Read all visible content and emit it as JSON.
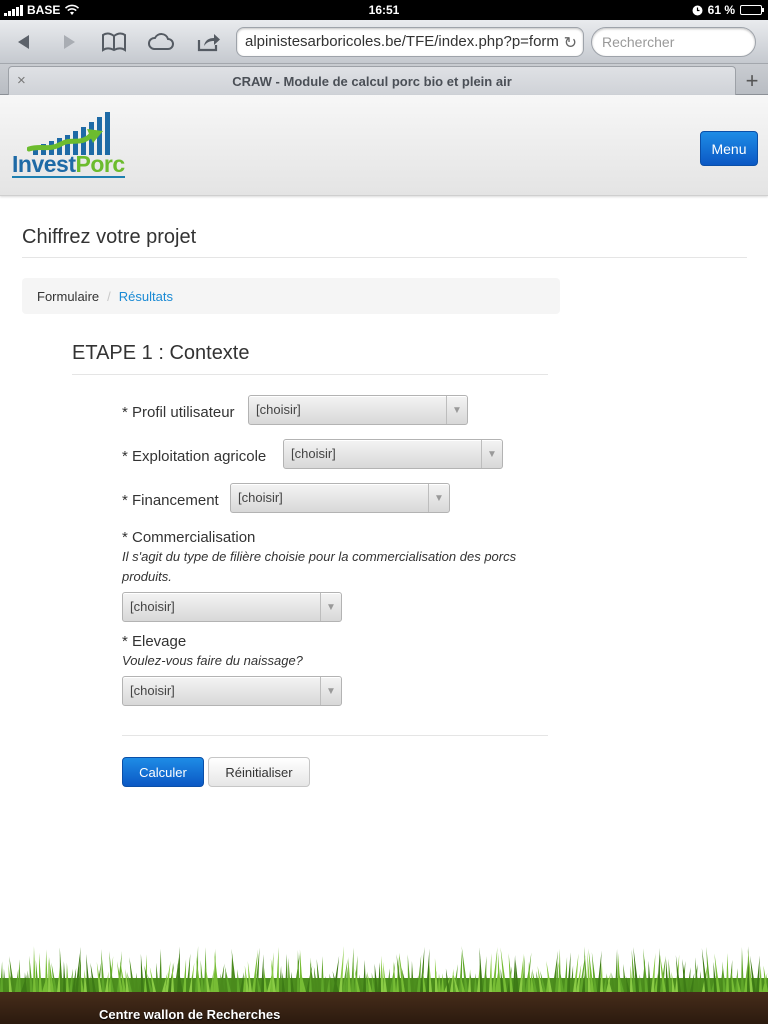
{
  "status_bar": {
    "carrier": "BASE",
    "time": "16:51",
    "battery": "61 %",
    "battery_level": 0.61
  },
  "browser": {
    "url": "alpinistesarboricoles.be/TFE/index.php?p=form",
    "search_placeholder": "Rechercher",
    "tab_title": "CRAW - Module de calcul porc bio et plein air",
    "tab_close": "×",
    "new_tab": "+",
    "icons": [
      "back-icon",
      "forward-icon",
      "bookmarks-icon",
      "icloud-icon",
      "share-icon",
      "reload-icon"
    ]
  },
  "header": {
    "logo_part1": "Invest",
    "logo_part2": "Porc",
    "menu_label": "Menu"
  },
  "page": {
    "title": "Chiffrez votre projet",
    "breadcrumb": {
      "current": "Formulaire",
      "separator": "/",
      "link": "Résultats"
    },
    "step_title": "ETAPE 1 : Contexte"
  },
  "form": {
    "fields": [
      {
        "label": "* Profil utilisateur",
        "value": "[choisir]"
      },
      {
        "label": "* Exploitation agricole",
        "value": "[choisir]"
      },
      {
        "label": "* Financement",
        "value": "[choisir]"
      },
      {
        "label": "* Commercialisation",
        "hint": "Il s'agit du type de filière choisie pour la commercialisation des porcs produits.",
        "value": "[choisir]"
      },
      {
        "label": "* Elevage",
        "hint": "Voulez-vous faire du naissage?",
        "value": "[choisir]"
      }
    ],
    "submit_label": "Calculer",
    "reset_label": "Réinitialiser"
  },
  "footer": {
    "text": "Centre wallon de Recherches"
  },
  "colors": {
    "primary_button": "#0b58c4",
    "link": "#1a8ad4",
    "logo_blue": "#1e6aa6",
    "logo_green": "#6cbc2e"
  }
}
